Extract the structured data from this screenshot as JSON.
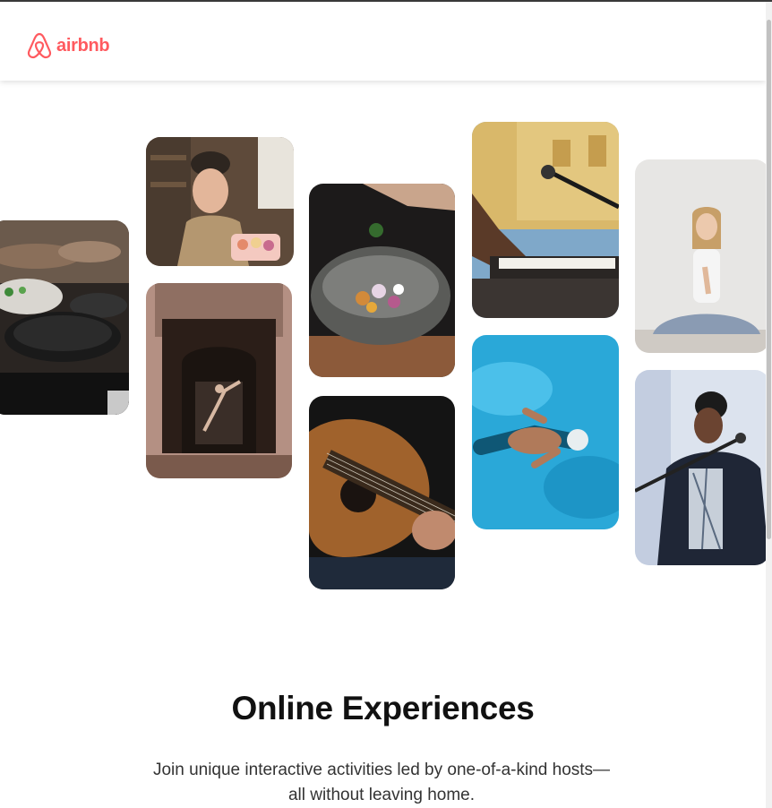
{
  "header": {
    "brand": "airbnb"
  },
  "hero": {
    "title": "Online Experiences",
    "subtitle": "Join unique interactive activities led by one-of-a-kind hosts—all without leaving home."
  },
  "gallery": {
    "photos": [
      "cooking-class-photo",
      "baker-with-pastries-photo",
      "dancer-in-doorway-photo",
      "food-bowl-photo",
      "guitar-player-photo",
      "piano-and-microphone-photo",
      "swimmer-photo",
      "yoga-meditation-photo",
      "singer-at-microphone-photo"
    ]
  },
  "colors": {
    "brand": "#ff5a5f",
    "text": "#111111"
  }
}
